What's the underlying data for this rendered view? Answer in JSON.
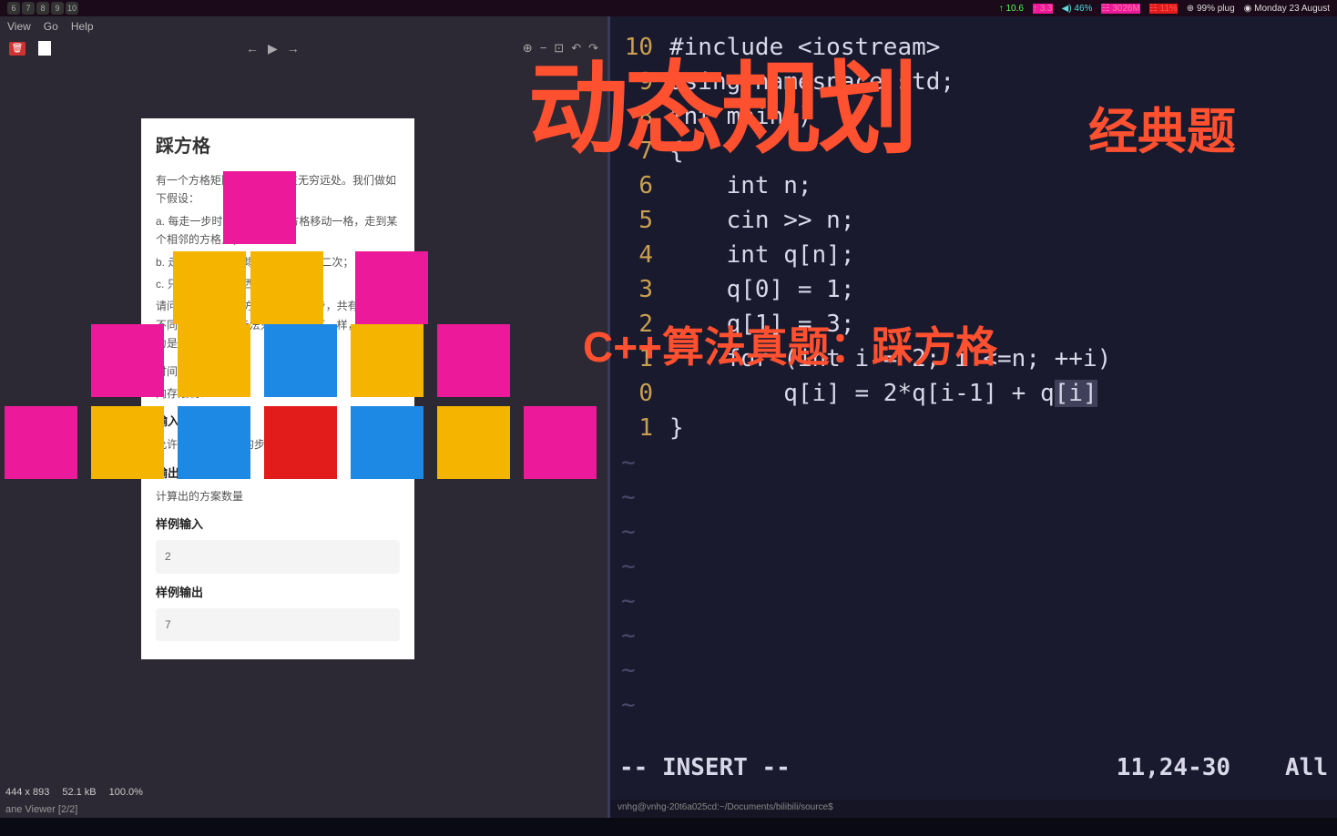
{
  "topbar": {
    "workspaces": [
      "6",
      "7",
      "8",
      "9",
      "10"
    ],
    "stats": {
      "s1": "↑ 10.6",
      "s2": "↑ 3.3",
      "s3": "◀) 46%",
      "s4": "☷ 3026M",
      "s5": "☷ 11%",
      "s6": "⊕ 99% plug",
      "s7": "◉ Monday 23 August"
    }
  },
  "leftmenu": {
    "view": "View",
    "go": "Go",
    "help": "Help"
  },
  "doc": {
    "title": "踩方格",
    "p1": "有一个方格矩阵，矩阵边界在无穷远处。我们做如下假设：",
    "p2": "a.    每走一步时，只能从当前方格移动一格，走到某个相邻的方格上；",
    "p3": "b.    走过的格子立即塌陷无法再走第二次；",
    "p4": "c.    只能向北、东、西三个方向走；",
    "p5": "请问：如果允许在方格矩阵上走n步，共有多少种不同的方案。2种走法只要有一步不一样，即被认为是不同的方案。",
    "p6": "时间限制：1000",
    "p7": "内存限制：65536",
    "input_h": "输入",
    "input_t": "允许在方格上行走的步数n(n <= 20)",
    "output_h": "输出",
    "output_t": "计算出的方案数量",
    "sin_h": "样例输入",
    "sin_v": "2",
    "sout_h": "样例输出",
    "sout_v": "7"
  },
  "leftstatus": {
    "dim": "444 x 893",
    "size": "52.1 kB",
    "zoom": "100.0%",
    "viewer": "ane Viewer [2/2]"
  },
  "editor": {
    "lines": [
      {
        "n": "10",
        "c": "#include <iostream>"
      },
      {
        "n": "9",
        "c": "using namespace std;"
      },
      {
        "n": "8",
        "c": "int main()"
      },
      {
        "n": "7",
        "c": "{"
      },
      {
        "n": "6",
        "c": "    int n;"
      },
      {
        "n": "5",
        "c": "    cin >> n;"
      },
      {
        "n": "4",
        "c": "    int q[n];"
      },
      {
        "n": "3",
        "c": "    q[0] = 1;"
      },
      {
        "n": "2",
        "c": "    q[1] = 3;"
      },
      {
        "n": "1",
        "c": "    for (int i = 2; i <=n; ++i)"
      },
      {
        "n": "0",
        "c": "        q[i] = 2*q[i-1] + q[i]"
      },
      {
        "n": "1",
        "c": "}"
      }
    ],
    "mode": "-- INSERT --",
    "pos": "11,24-30",
    "scroll": "All"
  },
  "terminal_status": "vnhg@vnhg-20t6a025cd:~/Documents/bilibili/source$",
  "overlay": {
    "main": "动态规划",
    "sub": "经典题",
    "cpp": "C++算法真题：踩方格"
  }
}
